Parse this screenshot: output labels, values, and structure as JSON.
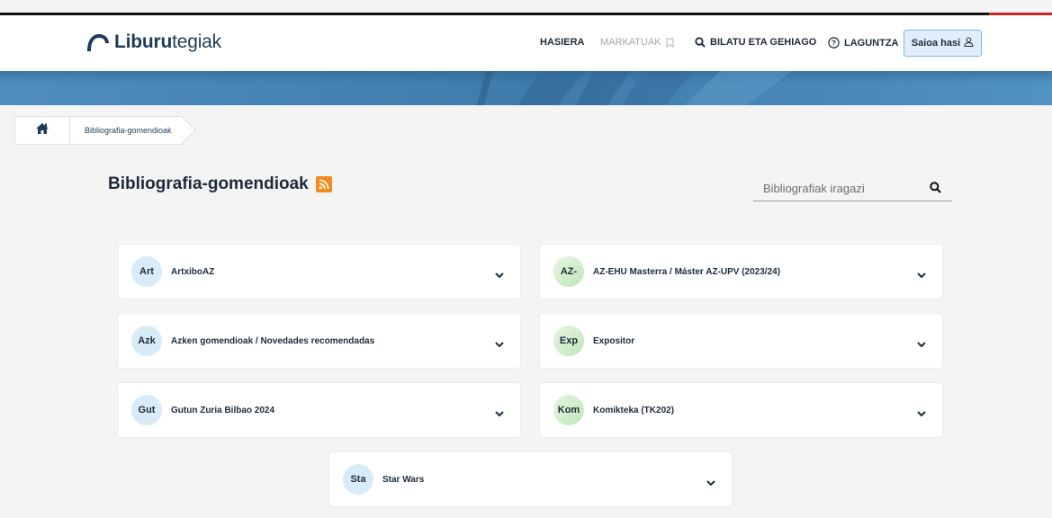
{
  "header": {
    "logo_bold": "Liburu",
    "logo_rest": "tegiak",
    "nav": [
      {
        "label": "HASIERA",
        "icon": ""
      },
      {
        "label": "MARKATUAK",
        "icon": "bookmark-icon"
      },
      {
        "label": "BILATU ETA GEHIAGO",
        "icon": "search-icon"
      },
      {
        "label": "LAGUNTZA",
        "icon": "help-icon"
      }
    ],
    "login_label": "Saioa hasi",
    "login_icon": "user-icon"
  },
  "breadcrumb": {
    "home_icon": "home-icon",
    "current": "Bibliografia-gomendioak"
  },
  "page": {
    "title": "Bibliografia-gomendioak",
    "rss_icon": "rss-icon",
    "filter_placeholder": "Bibliografiak iragazi"
  },
  "lists": [
    {
      "abbr": "Art",
      "label": "ArtxiboAZ",
      "avatar_color": "#d8ebf8"
    },
    {
      "abbr": "AZ-",
      "label": "AZ-EHU Masterra / Máster AZ-UPV (2023/24)",
      "avatar_color": "#cdebc6"
    },
    {
      "abbr": "Azk",
      "label": "Azken gomendioak / Novedades recomendadas",
      "avatar_color": "#d8ebf8"
    },
    {
      "abbr": "Exp",
      "label": "Expositor",
      "avatar_color": "#cdebc6"
    },
    {
      "abbr": "Gut",
      "label": "Gutun Zuria Bilbao 2024",
      "avatar_color": "#d8ebf8"
    },
    {
      "abbr": "Kom",
      "label": "Komikteka (TK202)",
      "avatar_color": "#cdebc6"
    },
    {
      "abbr": "Sta",
      "label": "Star Wars",
      "avatar_color": "#d8ebf8"
    }
  ],
  "colors": {
    "banner": "#4a86b7",
    "accent": "#1f3b57",
    "rss": "#f28a1e",
    "topline_red": "#c62828"
  }
}
